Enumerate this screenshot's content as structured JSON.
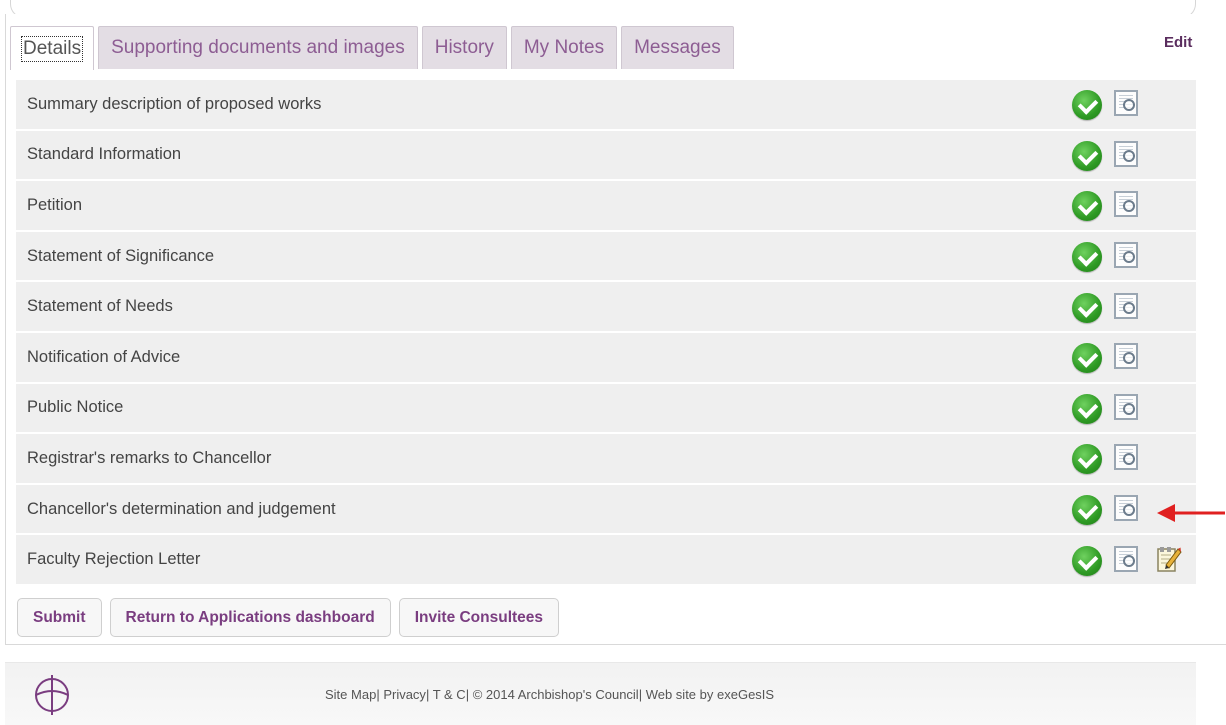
{
  "tabs": [
    {
      "label": "Details",
      "active": true
    },
    {
      "label": "Supporting documents and images",
      "active": false
    },
    {
      "label": "History",
      "active": false
    },
    {
      "label": "My Notes",
      "active": false
    },
    {
      "label": "Messages",
      "active": false
    }
  ],
  "edit_link": "Edit",
  "sections": [
    {
      "label": "Summary description of proposed works",
      "status": "complete",
      "icons": [
        "check-icon",
        "view-icon"
      ]
    },
    {
      "label": "Standard Information",
      "status": "complete",
      "icons": [
        "check-icon",
        "view-icon"
      ]
    },
    {
      "label": "Petition",
      "status": "complete",
      "icons": [
        "check-icon",
        "view-icon"
      ]
    },
    {
      "label": "Statement of Significance",
      "status": "complete",
      "icons": [
        "check-icon",
        "view-icon"
      ]
    },
    {
      "label": "Statement of Needs",
      "status": "complete",
      "icons": [
        "check-icon",
        "view-icon"
      ]
    },
    {
      "label": "Notification of Advice",
      "status": "complete",
      "icons": [
        "check-icon",
        "view-icon"
      ]
    },
    {
      "label": "Public Notice",
      "status": "complete",
      "icons": [
        "check-icon",
        "view-icon"
      ]
    },
    {
      "label": "Registrar's remarks to Chancellor",
      "status": "complete",
      "icons": [
        "check-icon",
        "view-icon"
      ]
    },
    {
      "label": "Chancellor's determination and judgement",
      "status": "complete",
      "icons": [
        "check-icon",
        "view-icon"
      ],
      "highlighted_by_arrow": true
    },
    {
      "label": "Faculty Rejection Letter",
      "status": "complete",
      "icons": [
        "check-icon",
        "view-icon",
        "edit-icon"
      ]
    }
  ],
  "buttons": {
    "submit": "Submit",
    "return": "Return to Applications dashboard",
    "invite": "Invite Consultees"
  },
  "footer": {
    "site_map": "Site Map",
    "privacy": "Privacy",
    "tc": "T & C",
    "copyright": "© 2014 Archbishop's Council",
    "credit": "Web site by exeGesIS",
    "separator": "| "
  },
  "colors": {
    "tab_text": "#8d5d93",
    "button_text": "#7a3d80",
    "row_bg": "#efefef",
    "check_green": "#2e9a24",
    "arrow_red": "#e02020"
  }
}
